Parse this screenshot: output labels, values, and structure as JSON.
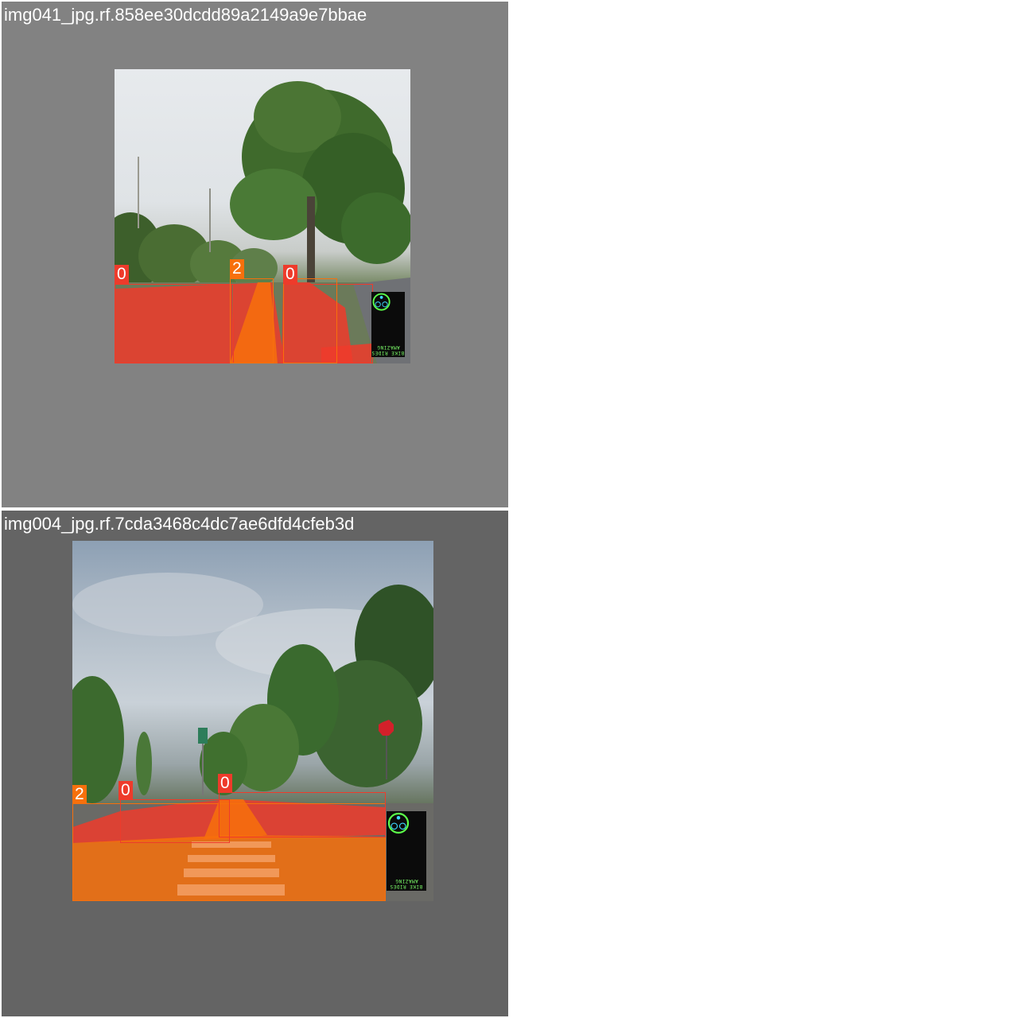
{
  "tiles": [
    {
      "title": "img041_jpg.rf.858ee30dcdd89a2149a9e7bbae",
      "labels": [
        "0",
        "2",
        "0"
      ],
      "logo": {
        "line1": "AMAZING",
        "line2": "BIKE RIDES"
      }
    },
    {
      "title": "img004_jpg.rf.7cda3468c4dc7ae6dfd4cfeb3d",
      "labels": [
        "2",
        "0",
        "0"
      ],
      "logo": {
        "line1": "AMAZING",
        "line2": "BIKE RIDES"
      }
    }
  ],
  "colors": {
    "class_0": "#ee3b2b",
    "class_2": "#f7700c",
    "tile_1_background": "#828282",
    "tile_2_background": "#646464",
    "logo_text": "#7dff6a"
  }
}
